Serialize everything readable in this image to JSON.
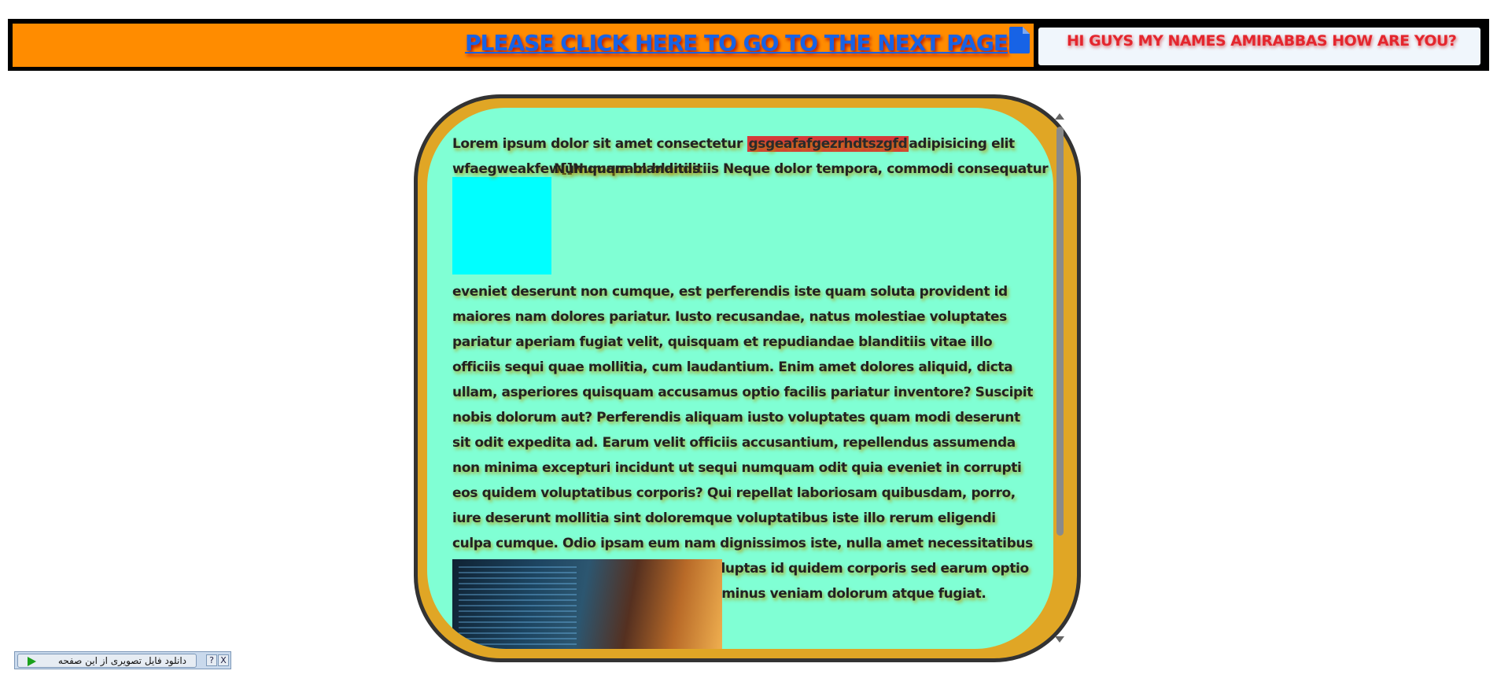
{
  "header": {
    "next_page_link": "PLEASE CLICK HERE TO GO TO THE NEXT PAGE",
    "doc_icon": "document-icon",
    "greeting": "HI GUYS MY NAMES AMIRABBAS HOW ARE YOU?"
  },
  "content": {
    "line1_before": "Lorem ipsum dolor sit amet consectetur ",
    "line1_highlight": "gsgeafafgezrhdtszgfd",
    "line1_after": "adipisicing elit",
    "line2_text": "wfaegweakfew[]Numquam blanditiis Neque dolor tempora, commodi consequatur",
    "line2_overlay": "Numquam blanditiis",
    "paragraph": "eveniet deserunt non cumque, est perferendis iste quam soluta provident id maiores nam dolores pariatur. Iusto recusandae, natus molestiae voluptates pariatur aperiam fugiat velit, quisquam et repudiandae blanditiis vitae illo officiis sequi quae mollitia, cum laudantium. Enim amet dolores aliquid, dicta ullam, asperiores quisquam accusamus optio facilis pariatur inventore? Suscipit nobis dolorum aut? Perferendis aliquam iusto voluptates quam modi deserunt sit odit expedita ad. Earum velit officiis accusantium, repellendus assumenda non minima excepturi incidunt ut sequi numquam odit quia eveniet in corrupti eos quidem voluptatibus corporis? Qui repellat laboriosam quibusdam, porro, iure deserunt mollitia sint doloremque voluptatibus iste illo rerum eligendi culpa cumque. Odio ipsam eum nam dignissimos iste, nulla amet necessitatibus hic fugiat vel libero suscipit unde. Voluptas id quidem corporis sed earum optio minima, quasi nemo, architecto odio minus veniam dolorum atque fugiat."
  },
  "download_bar": {
    "label": "دانلود فایل تصویری از این صفحه",
    "help": "?",
    "close": "X"
  },
  "colors": {
    "header_orange": "#ff8c00",
    "link_blue": "#1763e6",
    "greeting_red": "#e4262e",
    "panel_border": "#e0a625",
    "panel_bg": "#80ffd4",
    "highlight_red": "#d63a3a",
    "cyan_block": "#00ffff"
  }
}
